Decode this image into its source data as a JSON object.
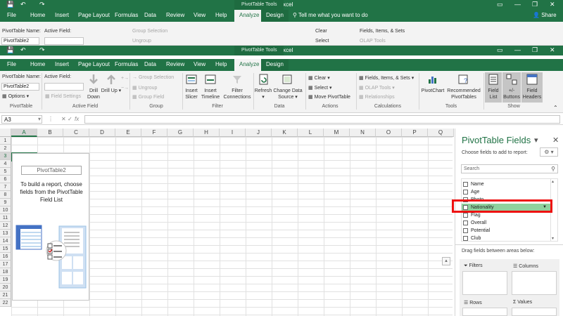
{
  "window": {
    "doc_title": "Book3 - Excel",
    "tools_label": "PivotTable Tools",
    "controls": [
      "ribbon-options",
      "minimize",
      "restore",
      "close"
    ]
  },
  "tabs": [
    "File",
    "Home",
    "Insert",
    "Page Layout",
    "Formulas",
    "Data",
    "Review",
    "View",
    "Help",
    "Analyze",
    "Design"
  ],
  "active_tab": "Analyze",
  "tell_me": "Tell me what you want to do",
  "share": "Share",
  "ribbon": {
    "pivot_name_label": "PivotTable Name:",
    "pivot_name_value": "PivotTable2",
    "options": "Options",
    "active_field_label": "Active Field:",
    "field_settings": "Field Settings",
    "drill_down": "Drill Down",
    "drill_up": "Drill Up",
    "group_selection": "Group Selection",
    "ungroup": "Ungroup",
    "group_field": "Group Field",
    "insert_slicer": "Insert Slicer",
    "insert_timeline": "Insert Timeline",
    "filter_connections": "Filter Connections",
    "refresh": "Refresh",
    "change_data_source": "Change Data Source",
    "clear": "Clear",
    "select": "Select",
    "move_pivottable": "Move PivotTable",
    "fields_items_sets": "Fields, Items, & Sets",
    "olap_tools": "OLAP Tools",
    "relationships": "Relationships",
    "pivotchart": "PivotChart",
    "recommended_pivottables": "Recommended PivotTables",
    "field_list": "Field List",
    "plus_minus_buttons": "+/- Buttons",
    "field_headers": "Field Headers",
    "groups": {
      "pivottable": "PivotTable",
      "active_field": "Active Field",
      "group": "Group",
      "filter": "Filter",
      "data": "Data",
      "actions": "Actions",
      "calculations": "Calculations",
      "tools": "Tools",
      "show": "Show"
    }
  },
  "formula_bar": {
    "name_box": "A3",
    "fx": "fx"
  },
  "sheet": {
    "columns": [
      "A",
      "B",
      "C",
      "D",
      "E",
      "F",
      "G",
      "H",
      "I",
      "J",
      "K",
      "L",
      "M",
      "N",
      "O",
      "P",
      "Q"
    ],
    "rows": [
      "1",
      "2",
      "3",
      "4",
      "5",
      "6",
      "7",
      "8",
      "9",
      "10",
      "11",
      "12",
      "13",
      "14",
      "15",
      "16",
      "17",
      "18",
      "19",
      "20",
      "21",
      "22"
    ],
    "selected_column": "A",
    "selected_row": "3"
  },
  "placeholder": {
    "name": "PivotTable2",
    "message": "To build a report, choose fields from the PivotTable Field List"
  },
  "pane": {
    "title": "PivotTable Fields",
    "subtitle": "Choose fields to add to report:",
    "search_placeholder": "Search",
    "fields": [
      "Name",
      "Age",
      "Photo",
      "Nationality",
      "Flag",
      "Overall",
      "Potential",
      "Club"
    ],
    "highlighted_field": "Nationality",
    "drag_text": "Drag fields between areas below:",
    "areas": [
      "Filters",
      "Columns",
      "Rows",
      "Values"
    ]
  },
  "colors": {
    "excel_green": "#217346",
    "highlight_green": "#8fd19e",
    "annotation_red": "#e11"
  }
}
